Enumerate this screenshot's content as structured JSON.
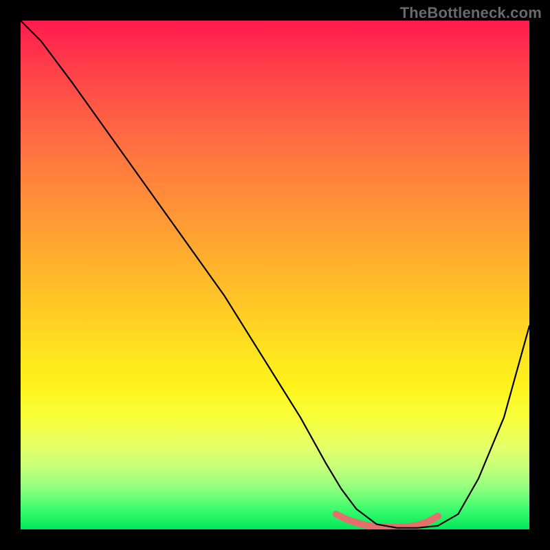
{
  "watermark": "TheBottleneck.com",
  "chart_data": {
    "type": "line",
    "title": "",
    "xlabel": "",
    "ylabel": "",
    "xlim": [
      0,
      100
    ],
    "ylim": [
      0,
      100
    ],
    "grid": false,
    "legend": false,
    "series": [
      {
        "name": "curve",
        "color": "#000000",
        "x": [
          0,
          4,
          10,
          20,
          30,
          40,
          50,
          55,
          60,
          63,
          66,
          70,
          74,
          78,
          82,
          86,
          90,
          95,
          100
        ],
        "values": [
          100,
          96,
          88,
          74,
          60,
          46,
          30,
          22,
          13,
          8,
          4,
          1,
          0.3,
          0.3,
          0.7,
          3,
          10,
          22,
          40
        ]
      },
      {
        "name": "highlight-band",
        "color": "#e46f6c",
        "x": [
          62,
          64,
          66,
          68,
          70,
          72,
          74,
          76,
          78,
          80,
          82
        ],
        "values": [
          3.0,
          2.0,
          1.3,
          0.8,
          0.5,
          0.4,
          0.4,
          0.5,
          0.8,
          1.5,
          2.6
        ]
      }
    ],
    "gradient_stops": [
      {
        "pos": 0,
        "color": "#ff1a4d"
      },
      {
        "pos": 50,
        "color": "#ffb22d"
      },
      {
        "pos": 75,
        "color": "#fff31c"
      },
      {
        "pos": 100,
        "color": "#00e85a"
      }
    ]
  }
}
